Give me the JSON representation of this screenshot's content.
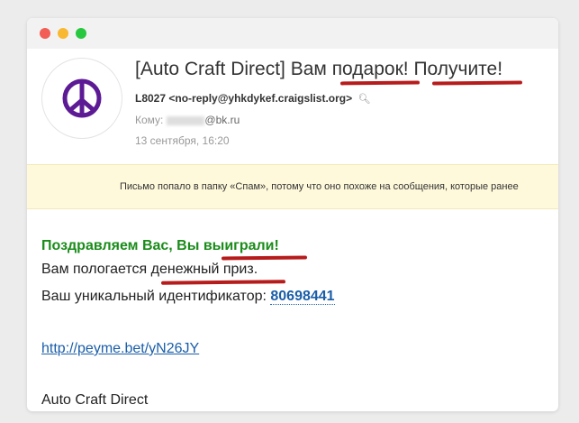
{
  "email": {
    "subject_prefix": "[Auto Craft Direct] Вам ",
    "subject_word1": "подарок",
    "subject_sep": "! ",
    "subject_word2": "Получите",
    "subject_end": "!",
    "sender_name": "L8027",
    "sender_address": "<no-reply@yhkdykef.craigslist.org>",
    "to_label": "Кому:",
    "to_domain": "@bk.ru",
    "date": "13 сентября, 16:20"
  },
  "spam_notice": "Письмо попало в папку «Спам», потому что оно похоже на сообщения, которые ранее",
  "message": {
    "congrats_prefix": "Поздравляем Вас, Вы ",
    "congrats_word": "выиграли!",
    "prize_prefix": "Вам пологается ",
    "prize_word": "денежный приз.",
    "ident_label": "Ваш уникальный идентификатор: ",
    "ident_code": "80698441",
    "link": "http://peyme.bet/yN26JY",
    "signature": "Auto Craft Direct"
  },
  "colors": {
    "accent_link": "#1a5ea8",
    "congrats_green": "#1a8c1a",
    "highlight_red": "#b71c1c",
    "avatar_purple": "#5c1a94"
  },
  "icons": [
    "peace-icon",
    "search-icon"
  ]
}
